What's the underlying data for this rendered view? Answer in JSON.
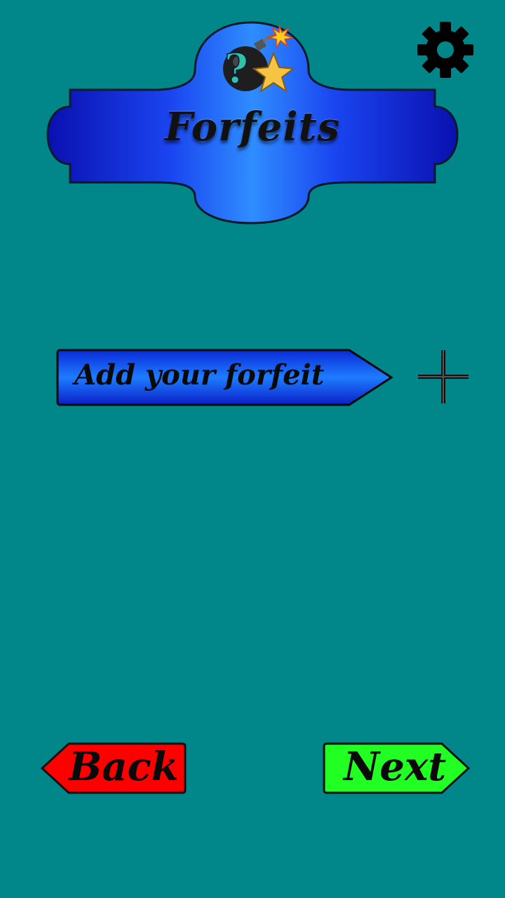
{
  "header": {
    "title": "Forfeits",
    "logo_icon": "bomb-question-star-icon",
    "settings_icon": "gear-icon"
  },
  "main": {
    "add_forfeit_label": "Add your forfeit",
    "add_icon": "plus-icon"
  },
  "navigation": {
    "back_label": "Back",
    "next_label": "Next"
  },
  "colors": {
    "background": "#01878a",
    "banner_blue": "#1a3cff",
    "back_red": "#ff0000",
    "next_green": "#22ff22"
  }
}
